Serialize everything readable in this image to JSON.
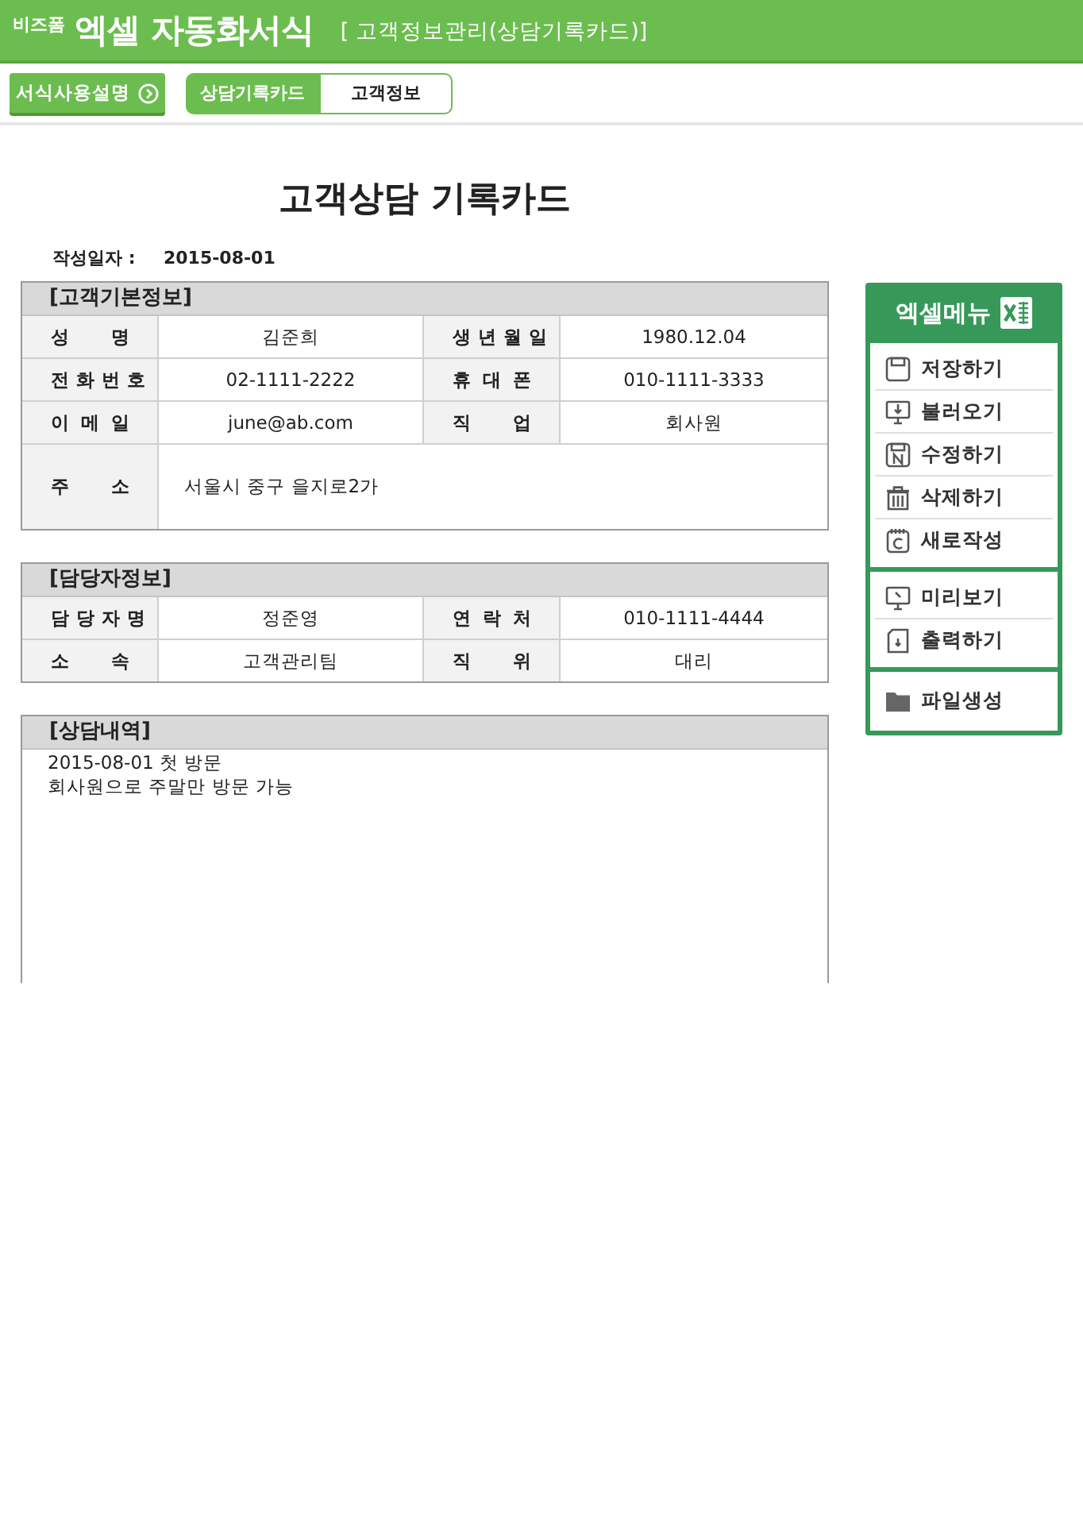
{
  "header": {
    "brand": "비즈폼",
    "title": "엑셀 자동화서식",
    "subtitle": "[ 고객정보관리(상담기록카드)]"
  },
  "toolbar": {
    "guide_button": "서식사용설명",
    "tabs": [
      {
        "label": "상담기록카드",
        "selected": true
      },
      {
        "label": "고객정보",
        "selected": false
      }
    ]
  },
  "document": {
    "title": "고객상담 기록카드",
    "date_label": "작성일자 :",
    "date": "2015-08-01",
    "sections": [
      {
        "kind": "grid",
        "title": "[고객기본정보]",
        "rows": [
          [
            {
              "label": "성 명",
              "value": "김준희"
            },
            {
              "label": "생 년 월 일",
              "value": "1980.12.04"
            }
          ],
          [
            {
              "label": "전 화 번 호",
              "value": "02-1111-2222"
            },
            {
              "label": "휴 대 폰",
              "value": "010-1111-3333"
            }
          ],
          [
            {
              "label": "이 메 일",
              "value": "june@ab.com"
            },
            {
              "label": "직 업",
              "value": "회사원"
            }
          ],
          [
            {
              "label": "주 소",
              "value": "서울시 중구 을지로2가"
            }
          ]
        ]
      },
      {
        "kind": "grid",
        "title": "[담당자정보]",
        "rows": [
          [
            {
              "label": "담 당 자 명",
              "value": "정준영"
            },
            {
              "label": "연 락 처",
              "value": "010-1111-4444"
            }
          ],
          [
            {
              "label": "소 속",
              "value": "고객관리팀"
            },
            {
              "label": "직 위",
              "value": "대리"
            }
          ]
        ]
      },
      {
        "kind": "notes",
        "title": "[상담내역]",
        "lines": [
          "2015-08-01 첫 방문",
          "회사원으로 주말만 방문 가능"
        ]
      }
    ]
  },
  "excel_menu": {
    "title": "엑셀메뉴",
    "groups": [
      [
        {
          "kind": "save",
          "label": "저장하기"
        },
        {
          "kind": "load",
          "label": "불러오기"
        },
        {
          "kind": "edit",
          "label": "수정하기"
        },
        {
          "kind": "delete",
          "label": "삭제하기"
        },
        {
          "kind": "new",
          "label": "새로작성"
        }
      ],
      [
        {
          "kind": "preview",
          "label": "미리보기"
        },
        {
          "kind": "print",
          "label": "출력하기"
        }
      ],
      [
        {
          "kind": "file",
          "label": "파일생성"
        }
      ]
    ]
  }
}
